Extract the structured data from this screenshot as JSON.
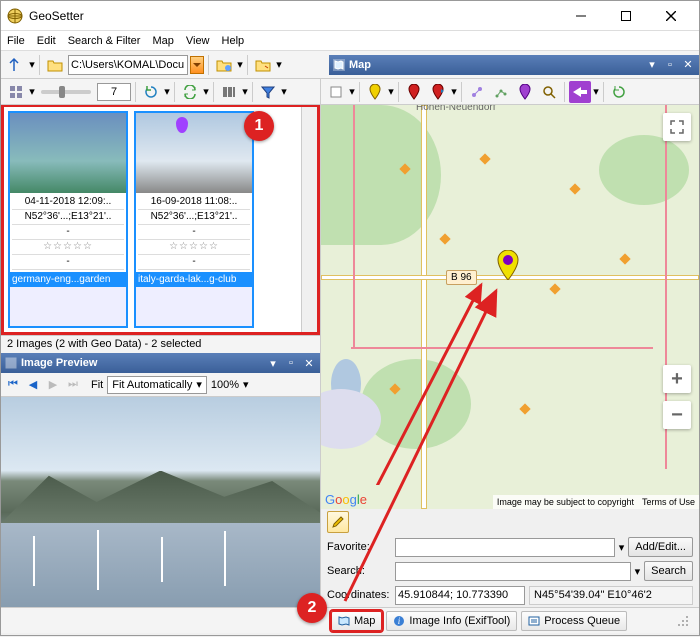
{
  "window": {
    "title": "GeoSetter"
  },
  "menu": {
    "file": "File",
    "edit": "Edit",
    "search": "Search & Filter",
    "map": "Map",
    "view": "View",
    "help": "Help"
  },
  "path": "C:\\Users\\KOMAL\\Docu",
  "thumbsize": "7",
  "thumbs": [
    {
      "date": "04-11-2018 12:09:..",
      "coord": "N52°36'...;E13°21'..",
      "name": "germany-eng...garden"
    },
    {
      "date": "16-09-2018 11:08:..",
      "coord": "N52°36'...;E13°21'..",
      "name": "italy-garda-lak...g-club"
    }
  ],
  "status": "2 Images (2 with Geo Data) - 2 selected",
  "preview": {
    "title": "Image Preview",
    "fit": "Fit",
    "fitauto": "Fit Automatically",
    "zoom": "100%"
  },
  "mappanel": {
    "title": "Map"
  },
  "mapinfo": {
    "toplabel": "Hohen-Neuendorf",
    "roadlabel": "B 96",
    "copy": "Image may be subject to copyright",
    "terms": "Terms of Use"
  },
  "form": {
    "favorite_label": "Favorite:",
    "addedit": "Add/Edit...",
    "search_label": "Search:",
    "search_btn": "Search",
    "coords_label": "Coordinates:",
    "coords_value": "45.910844; 10.773390",
    "coords_dms": "N45°54'39.04\" E10°46'2"
  },
  "tabs": {
    "map": "Map",
    "info": "Image Info (ExifTool)",
    "queue": "Process Queue"
  },
  "callouts": {
    "one": "1",
    "two": "2"
  }
}
